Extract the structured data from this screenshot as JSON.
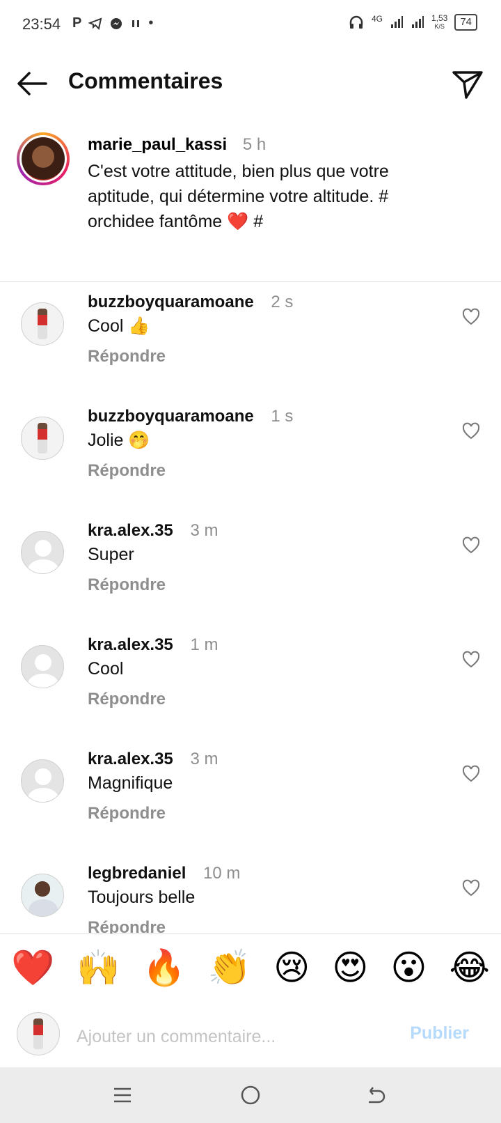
{
  "status_bar": {
    "time": "23:54",
    "left_icons": [
      "P",
      "telegram-icon",
      "messenger-icon",
      "pause-icon",
      "•"
    ],
    "network": "4G",
    "speed_value": "1,53",
    "speed_unit": "K/S",
    "battery": "74"
  },
  "header": {
    "title": "Commentaires"
  },
  "caption": {
    "username": "marie_paul_kassi",
    "time": "5 h",
    "text": "C'est votre attitude, bien plus que votre aptitude, qui détermine votre altitude. # orchidee fantôme ❤️ #"
  },
  "comments": [
    {
      "username": "buzzboyquaramoane",
      "time": "2 s",
      "text": "Cool 👍",
      "reply": "Répondre",
      "avatar": "person"
    },
    {
      "username": "buzzboyquaramoane",
      "time": "1 s",
      "text": "Jolie 🤭",
      "reply": "Répondre",
      "avatar": "person"
    },
    {
      "username": "kra.alex.35",
      "time": "3 m",
      "text": "Super",
      "reply": "Répondre",
      "avatar": "default"
    },
    {
      "username": "kra.alex.35",
      "time": "1 m",
      "text": "Cool",
      "reply": "Répondre",
      "avatar": "default"
    },
    {
      "username": "kra.alex.35",
      "time": "3 m",
      "text": "Magnifique",
      "reply": "Répondre",
      "avatar": "default"
    },
    {
      "username": "legbredaniel",
      "time": "10 m",
      "text": "Toujours belle",
      "reply": "Répondre",
      "avatar": "photo"
    }
  ],
  "emoji_bar": [
    "❤️",
    "🙌",
    "🔥",
    "👏",
    "😢",
    "😍",
    "😮",
    "😂"
  ],
  "composer": {
    "placeholder": "Ajouter un commentaire...",
    "publish_label": "Publier"
  },
  "colors": {
    "accent_disabled": "#b6dafb",
    "muted_text": "#8e8e8e",
    "divider": "#dedede"
  }
}
